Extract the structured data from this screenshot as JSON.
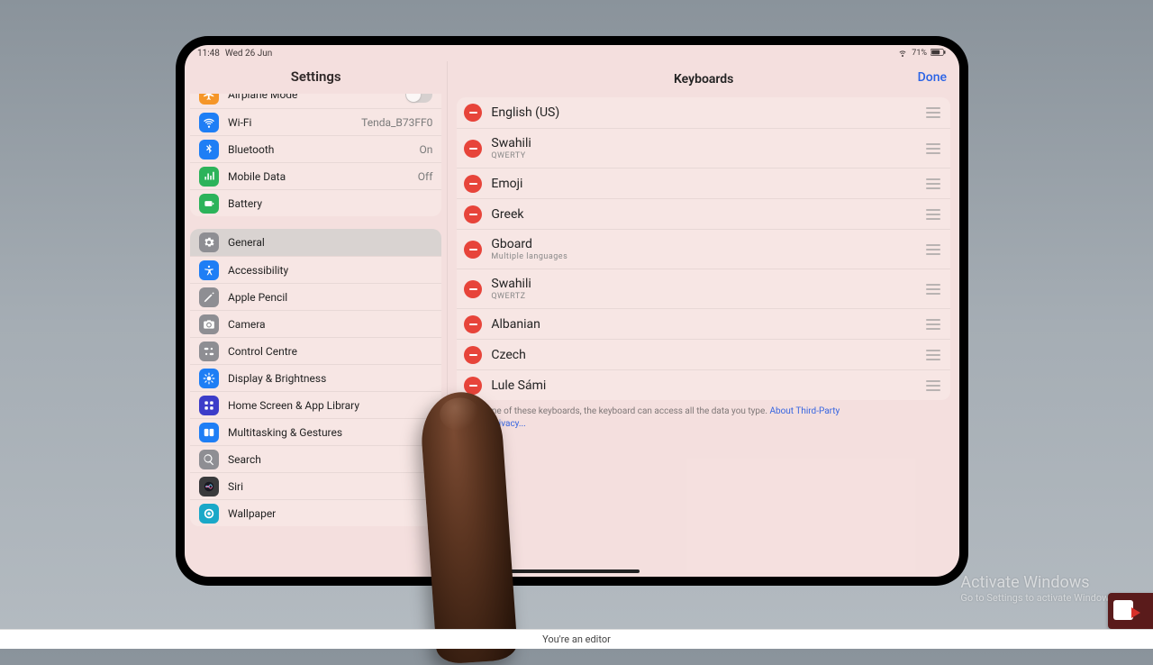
{
  "status": {
    "time": "11:48",
    "date": "Wed 26 Jun",
    "battery": "71%"
  },
  "sidebar": {
    "title": "Settings",
    "groups": [
      {
        "items": [
          {
            "id": "airplane",
            "label": "Airplane Mode",
            "value": "",
            "color": "#f59628",
            "toggle": true
          },
          {
            "id": "wifi",
            "label": "Wi-Fi",
            "value": "Tenda_B73FF0",
            "color": "#1e7ef5"
          },
          {
            "id": "bluetooth",
            "label": "Bluetooth",
            "value": "On",
            "color": "#1e7ef5"
          },
          {
            "id": "mobile-data",
            "label": "Mobile Data",
            "value": "Off",
            "color": "#2cb35a"
          },
          {
            "id": "battery",
            "label": "Battery",
            "value": "",
            "color": "#2cb35a"
          }
        ]
      },
      {
        "items": [
          {
            "id": "general",
            "label": "General",
            "color": "#8e8e93",
            "selected": true
          },
          {
            "id": "accessibility",
            "label": "Accessibility",
            "color": "#1e7ef5"
          },
          {
            "id": "apple-pencil",
            "label": "Apple Pencil",
            "color": "#8e8e93"
          },
          {
            "id": "camera",
            "label": "Camera",
            "color": "#8e8e93"
          },
          {
            "id": "control-centre",
            "label": "Control Centre",
            "color": "#8e8e93"
          },
          {
            "id": "display",
            "label": "Display & Brightness",
            "color": "#1e7ef5"
          },
          {
            "id": "home-screen",
            "label": "Home Screen & App Library",
            "color": "#3c3cc9"
          },
          {
            "id": "multitasking",
            "label": "Multitasking & Gestures",
            "color": "#1e7ef5"
          },
          {
            "id": "search",
            "label": "Search",
            "color": "#8e8e93"
          },
          {
            "id": "siri",
            "label": "Siri",
            "color": "#3a3a3c"
          },
          {
            "id": "wallpaper",
            "label": "Wallpaper",
            "color": "#1aa8c8"
          }
        ]
      }
    ]
  },
  "detail": {
    "title": "Keyboards",
    "done": "Done",
    "keyboards": [
      {
        "name": "English (US)",
        "sub": ""
      },
      {
        "name": "Swahili",
        "sub": "QWERTY"
      },
      {
        "name": "Emoji",
        "sub": ""
      },
      {
        "name": "Greek",
        "sub": ""
      },
      {
        "name": "Gboard",
        "sub": "Multiple languages"
      },
      {
        "name": "Swahili",
        "sub": "QWERTZ"
      },
      {
        "name": "Albanian",
        "sub": ""
      },
      {
        "name": "Czech",
        "sub": ""
      },
      {
        "name": "Lule Sámi",
        "sub": ""
      }
    ],
    "footer_prefix": "using one of these keyboards, the keyboard can access all the data you type. ",
    "footer_link": "About Third-Party",
    "footer_suffix": "ards & Privacy..."
  },
  "watermark": {
    "title": "Activate Windows",
    "sub": "Go to Settings to activate Windows."
  },
  "bottom_bar": "You're an editor"
}
